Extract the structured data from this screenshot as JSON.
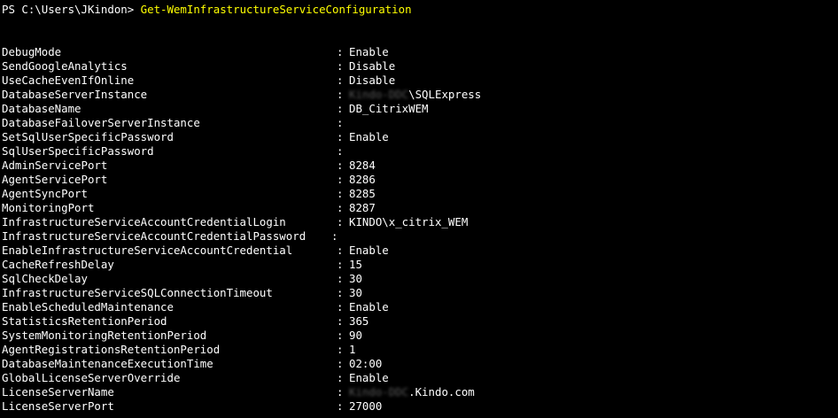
{
  "prompt": {
    "path": "PS C:\\Users\\JKindon>",
    "command": "Get-WemInfrastructureServiceConfiguration"
  },
  "separator": ":",
  "properties": [
    {
      "name": "DebugMode",
      "value": "Enable"
    },
    {
      "name": "SendGoogleAnalytics",
      "value": "Disable"
    },
    {
      "name": "UseCacheEvenIfOnline",
      "value": "Disable"
    },
    {
      "name": "DatabaseServerInstance",
      "redacted": "Kindo-DDC",
      "value": "\\SQLExpress"
    },
    {
      "name": "DatabaseName",
      "value": "DB_CitrixWEM"
    },
    {
      "name": "DatabaseFailoverServerInstance",
      "value": ""
    },
    {
      "name": "SetSqlUserSpecificPassword",
      "value": "Enable"
    },
    {
      "name": "SqlUserSpecificPassword",
      "value": ""
    },
    {
      "name": "AdminServicePort",
      "value": "8284"
    },
    {
      "name": "AgentServicePort",
      "value": "8286"
    },
    {
      "name": "AgentSyncPort",
      "value": "8285"
    },
    {
      "name": "MonitoringPort",
      "value": "8287"
    },
    {
      "name": "InfrastructureServiceAccountCredentialLogin",
      "value": "KINDO\\x_citrix_WEM"
    },
    {
      "name": "InfrastructureServiceAccountCredentialPassword",
      "value": ""
    },
    {
      "name": "EnableInfrastructureServiceAccountCredential",
      "value": "Enable"
    },
    {
      "name": "CacheRefreshDelay",
      "value": "15"
    },
    {
      "name": "SqlCheckDelay",
      "value": "30"
    },
    {
      "name": "InfrastructureServiceSQLConnectionTimeout",
      "value": "30"
    },
    {
      "name": "EnableScheduledMaintenance",
      "value": "Enable"
    },
    {
      "name": "StatisticsRetentionPeriod",
      "value": "365"
    },
    {
      "name": "SystemMonitoringRetentionPeriod",
      "value": "90"
    },
    {
      "name": "AgentRegistrationsRetentionPeriod",
      "value": "1"
    },
    {
      "name": "DatabaseMaintenanceExecutionTime",
      "value": "02:00"
    },
    {
      "name": "GlobalLicenseServerOverride",
      "value": "Enable"
    },
    {
      "name": "LicenseServerName",
      "redacted": "Kindo-DDC",
      "value": ".Kindo.com"
    },
    {
      "name": "LicenseServerPort",
      "value": "27000"
    }
  ]
}
